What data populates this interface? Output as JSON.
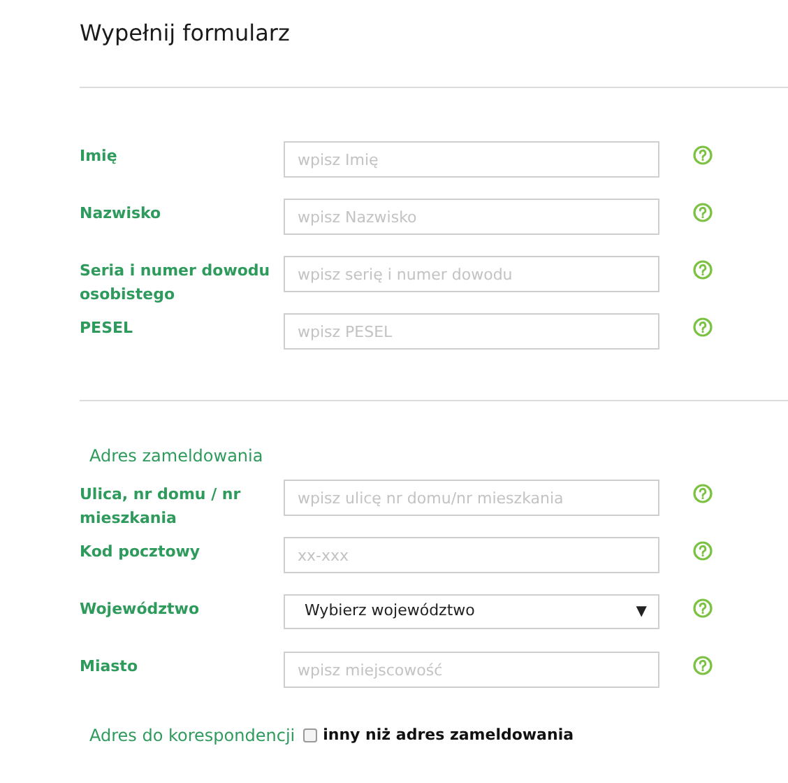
{
  "title": "Wypełnij formularz",
  "personal_fields": [
    {
      "kind": "text",
      "label": "Imię",
      "placeholder": "wpisz Imię"
    },
    {
      "kind": "text",
      "label": "Nazwisko",
      "placeholder": "wpisz Nazwisko"
    },
    {
      "kind": "text",
      "label": "Seria i numer dowodu osobistego",
      "placeholder": "wpisz serię i numer dowodu"
    },
    {
      "kind": "text",
      "label": "PESEL",
      "placeholder": "wpisz PESEL"
    }
  ],
  "address": {
    "heading": "Adres zameldowania",
    "fields": [
      {
        "kind": "text",
        "label": "Ulica, nr domu / nr mieszkania",
        "placeholder": "wpisz ulicę nr domu/nr mieszkania"
      },
      {
        "kind": "text",
        "label": "Kod pocztowy",
        "placeholder": "xx-xxx"
      },
      {
        "kind": "select",
        "label": "Województwo",
        "value": "Wybierz województwo",
        "caret": "▼"
      },
      {
        "kind": "text",
        "label": "Miasto",
        "placeholder": "wpisz miejscowość"
      }
    ]
  },
  "correspondence": {
    "heading": "Adres do korespondencji",
    "checkbox": {
      "label": "inny niż adres zameldowania",
      "checked": false
    }
  }
}
